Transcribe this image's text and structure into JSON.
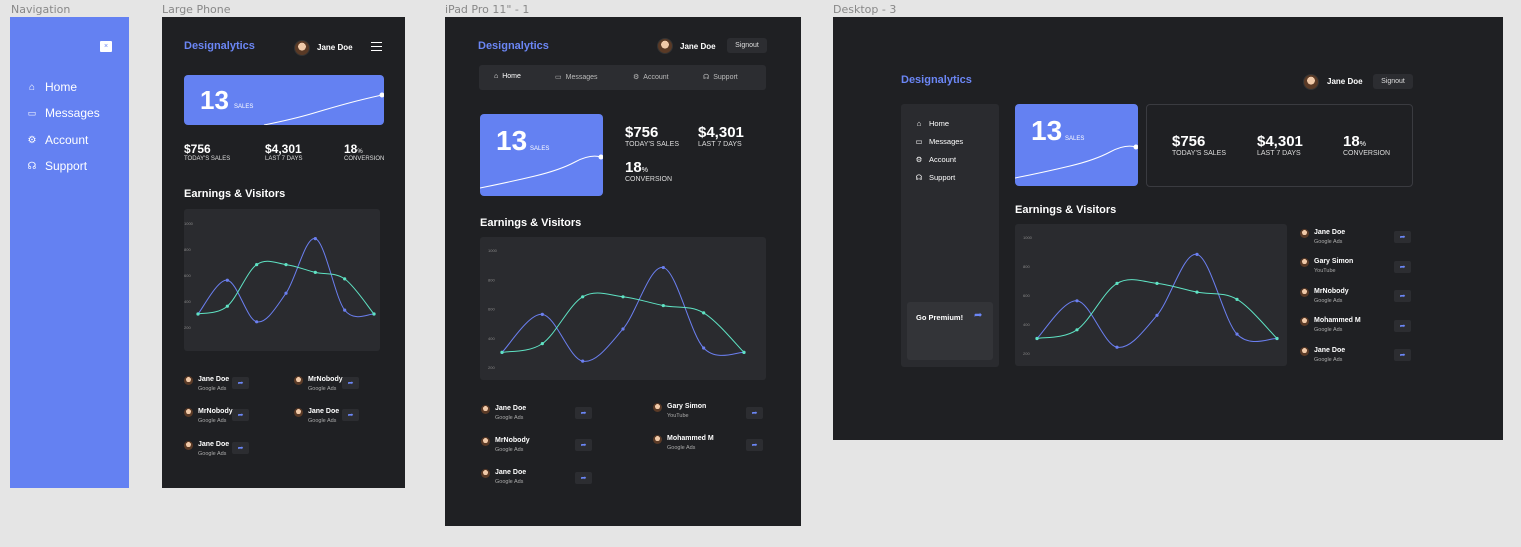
{
  "frames": {
    "navigation": "Navigation",
    "phone": "Large Phone",
    "ipad": "iPad Pro 11\" - 1",
    "desktop": "Desktop - 3"
  },
  "brand": "Designalytics",
  "user": {
    "name": "Jane Doe"
  },
  "signout_label": "Signout",
  "close_label": "×",
  "menu_icon": "hamburger-icon",
  "nav": [
    {
      "label": "Home",
      "icon": "home-icon"
    },
    {
      "label": "Messages",
      "icon": "message-icon"
    },
    {
      "label": "Account",
      "icon": "gear-icon"
    },
    {
      "label": "Support",
      "icon": "headset-icon"
    }
  ],
  "sales_card": {
    "value": "13",
    "label": "SALES"
  },
  "stats": [
    {
      "value": "$756",
      "label": "TODAY'S SALES"
    },
    {
      "value": "$4,301",
      "label": "LAST 7 DAYS"
    },
    {
      "value": "18",
      "unit": "%",
      "label": "CONVERSION"
    }
  ],
  "section_title": "Earnings & Visitors",
  "premium_label": "Go Premium!",
  "chart_data": {
    "type": "line",
    "title": "Earnings & Visitors",
    "x": [
      0,
      1,
      2,
      3,
      4,
      5,
      6
    ],
    "ylim": [
      200,
      1000
    ],
    "yticks": [
      "1000",
      "800",
      "600",
      "400",
      "200"
    ],
    "series": [
      {
        "color": "#6b7ff0",
        "values": [
          300,
          560,
          240,
          460,
          880,
          330,
          300
        ]
      },
      {
        "color": "#5fe3c4",
        "values": [
          300,
          360,
          680,
          680,
          620,
          570,
          300
        ]
      }
    ]
  },
  "referrers": {
    "phone": [
      {
        "name": "Jane Doe",
        "source": "Google Ads"
      },
      {
        "name": "MrNobody",
        "source": "Google Ads"
      },
      {
        "name": "MrNobody",
        "source": "Google Ads"
      },
      {
        "name": "Jane Doe",
        "source": "Google Ads"
      },
      {
        "name": "Jane Doe",
        "source": "Google Ads"
      }
    ],
    "ipad": [
      {
        "name": "Jane Doe",
        "source": "Google Ads"
      },
      {
        "name": "Gary Simon",
        "source": "YouTube"
      },
      {
        "name": "MrNobody",
        "source": "Google Ads"
      },
      {
        "name": "Mohammed M",
        "source": "Google Ads"
      },
      {
        "name": "Jane Doe",
        "source": "Google Ads"
      }
    ],
    "desktop": [
      {
        "name": "Jane Doe",
        "source": "Google Ads"
      },
      {
        "name": "Gary Simon",
        "source": "YouTube"
      },
      {
        "name": "MrNobody",
        "source": "Google Ads"
      },
      {
        "name": "Mohammed M",
        "source": "Google Ads"
      },
      {
        "name": "Jane Doe",
        "source": "Google Ads"
      }
    ]
  },
  "colors": {
    "accent": "#6481f2",
    "background": "#1f2023",
    "panel": "#2a2b2f",
    "line_blue": "#6b7ff0",
    "line_teal": "#5fe3c4"
  }
}
